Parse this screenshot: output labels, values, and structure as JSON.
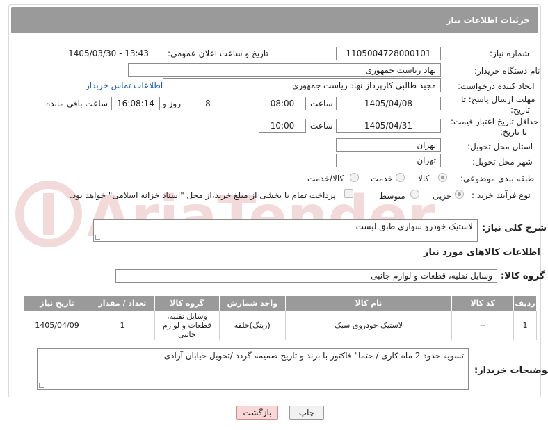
{
  "header": {
    "title": "جزئیات اطلاعات نیاز"
  },
  "form": {
    "need_number_label": "شماره نیاز:",
    "need_number": "1105004728000101",
    "announce_label": "تاریخ و ساعت اعلان عمومی:",
    "announce_value": "1405/03/30 - 13:43",
    "buyer_org_label": "نام دستگاه خریدار:",
    "buyer_org": "نهاد ریاست جمهوری",
    "creator_label": "ایجاد کننده درخواست:",
    "creator": "مجید طالبی کارپرداز نهاد ریاست جمهوری",
    "contact_link": "اطلاعات تماس خریدار",
    "deadline_label_1": "مهلت ارسال پاسخ: تا",
    "deadline_label_2": "تاریخ:",
    "deadline_date": "1405/04/08",
    "time_label": "ساعت",
    "deadline_time": "08:00",
    "days_value": "8",
    "days_label": "روز و",
    "remaining_time": "16:08:14",
    "remaining_label": "ساعت باقی مانده",
    "price_validity_label_1": "حداقل تاریخ اعتبار قیمت:",
    "price_validity_label_2": "تا تاریخ:",
    "price_validity_date": "1405/04/31",
    "price_validity_time": "10:00",
    "province_label": "استان محل تحویل:",
    "province": "تهران",
    "city_label": "شهر محل تحویل:",
    "city": "تهران",
    "category_label": "طبقه بندی موضوعی:",
    "category_options": [
      "کالا",
      "خدمت",
      "کالا/خدمت"
    ],
    "process_label": "نوع فرآیند خرید :",
    "process_options": [
      "جزیی",
      "متوسط"
    ],
    "payment_note": "پرداخت تمام یا بخشی از مبلغ خرید،از محل \"اسناد خزانه اسلامی\" خواهد بود.",
    "description_label": "شرح کلی نیاز:",
    "description": "لاستیک خودرو سواری طبق لیست",
    "goods_info_title": "اطلاعات کالاهای مورد نیاز",
    "goods_group_label": "گروه کالا:",
    "goods_group": "وسایل نقلیه، قطعات و لوازم جانبی"
  },
  "table": {
    "headers": [
      "ردیف",
      "کد کالا",
      "نام کالا",
      "واحد شمارش",
      "گروه کالا",
      "تعداد / مقدار",
      "تاریخ نیاز"
    ],
    "rows": [
      {
        "row": "1",
        "code": "--",
        "name": "لاستیک خودروی سبک",
        "unit": "(رینگ)حلقه",
        "group": "وسایل نقلیه، قطعات و لوازم جانبی",
        "qty": "1",
        "date": "1405/04/09"
      }
    ]
  },
  "notes": {
    "label": "توضیحات خریدار:",
    "text": "تسویه حدود 2 ماه کاری / حتما\" فاکتور با برند و تاریخ ضمیمه گردد /تحویل خیابان آزادی"
  },
  "buttons": {
    "print": "چاپ",
    "back": "بازگشت"
  },
  "watermark": {
    "text": "AriaTender.neT"
  }
}
